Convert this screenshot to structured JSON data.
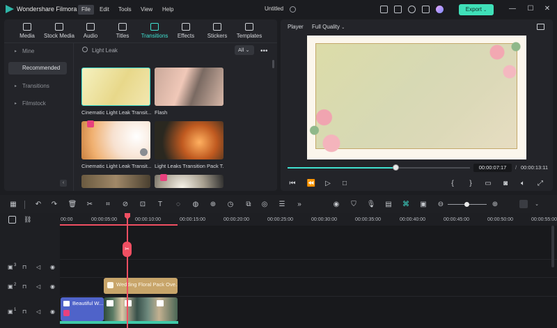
{
  "app": {
    "name": "Wondershare Filmora",
    "window_title": "Untitled",
    "export_label": "Export"
  },
  "menu": [
    "File",
    "Edit",
    "Tools",
    "View",
    "Help"
  ],
  "toolbar": [
    {
      "label": "Media",
      "icon": "media-icon"
    },
    {
      "label": "Stock Media",
      "icon": "stock-media-icon"
    },
    {
      "label": "Audio",
      "icon": "audio-icon"
    },
    {
      "label": "Titles",
      "icon": "titles-icon"
    },
    {
      "label": "Transitions",
      "icon": "transitions-icon",
      "active": true
    },
    {
      "label": "Effects",
      "icon": "effects-icon"
    },
    {
      "label": "Stickers",
      "icon": "stickers-icon"
    },
    {
      "label": "Templates",
      "icon": "templates-icon"
    }
  ],
  "sidebar": [
    {
      "label": "Mine"
    },
    {
      "label": "Recommended",
      "active": true
    },
    {
      "label": "Transitions"
    },
    {
      "label": "Filmstock"
    }
  ],
  "search": {
    "value": "Light Leak",
    "filter": "All"
  },
  "items": [
    {
      "label": "Cinematic Light Leak Transit...",
      "premium": false
    },
    {
      "label": "Flash",
      "premium": false
    },
    {
      "label": "Cinematic Light Leak Transit...",
      "premium": true
    },
    {
      "label": "Light Leaks Transition Pack T...",
      "premium": false
    }
  ],
  "player": {
    "label": "Player",
    "quality": "Full Quality",
    "current_time": "00:00:07:17",
    "total_time": "00:00:13:11",
    "separator": "/",
    "progress": 0.59,
    "brace_open": "{",
    "brace_close": "}"
  },
  "timeline": {
    "ruler": [
      "00:00",
      "00:00:05:00",
      "00:00:10:00",
      "00:00:15:00",
      "00:00:20:00",
      "00:00:25:00",
      "00:00:30:00",
      "00:00:35:00",
      "00:00:40:00",
      "00:00:45:00",
      "00:00:50:00",
      "00:00:55:00"
    ],
    "tracks": [
      {
        "number": "3"
      },
      {
        "number": "2"
      },
      {
        "number": "1"
      }
    ],
    "clips": {
      "title_clip": "Wedding Floral Pack Ove...",
      "video_clip": "Beautiful W..."
    }
  },
  "colors": {
    "accent": "#3fe0d0",
    "export": "#3fe0b8",
    "playhead": "#f04f62",
    "title_clip": "#c8a56a",
    "video_clip": "#4f63c9"
  }
}
